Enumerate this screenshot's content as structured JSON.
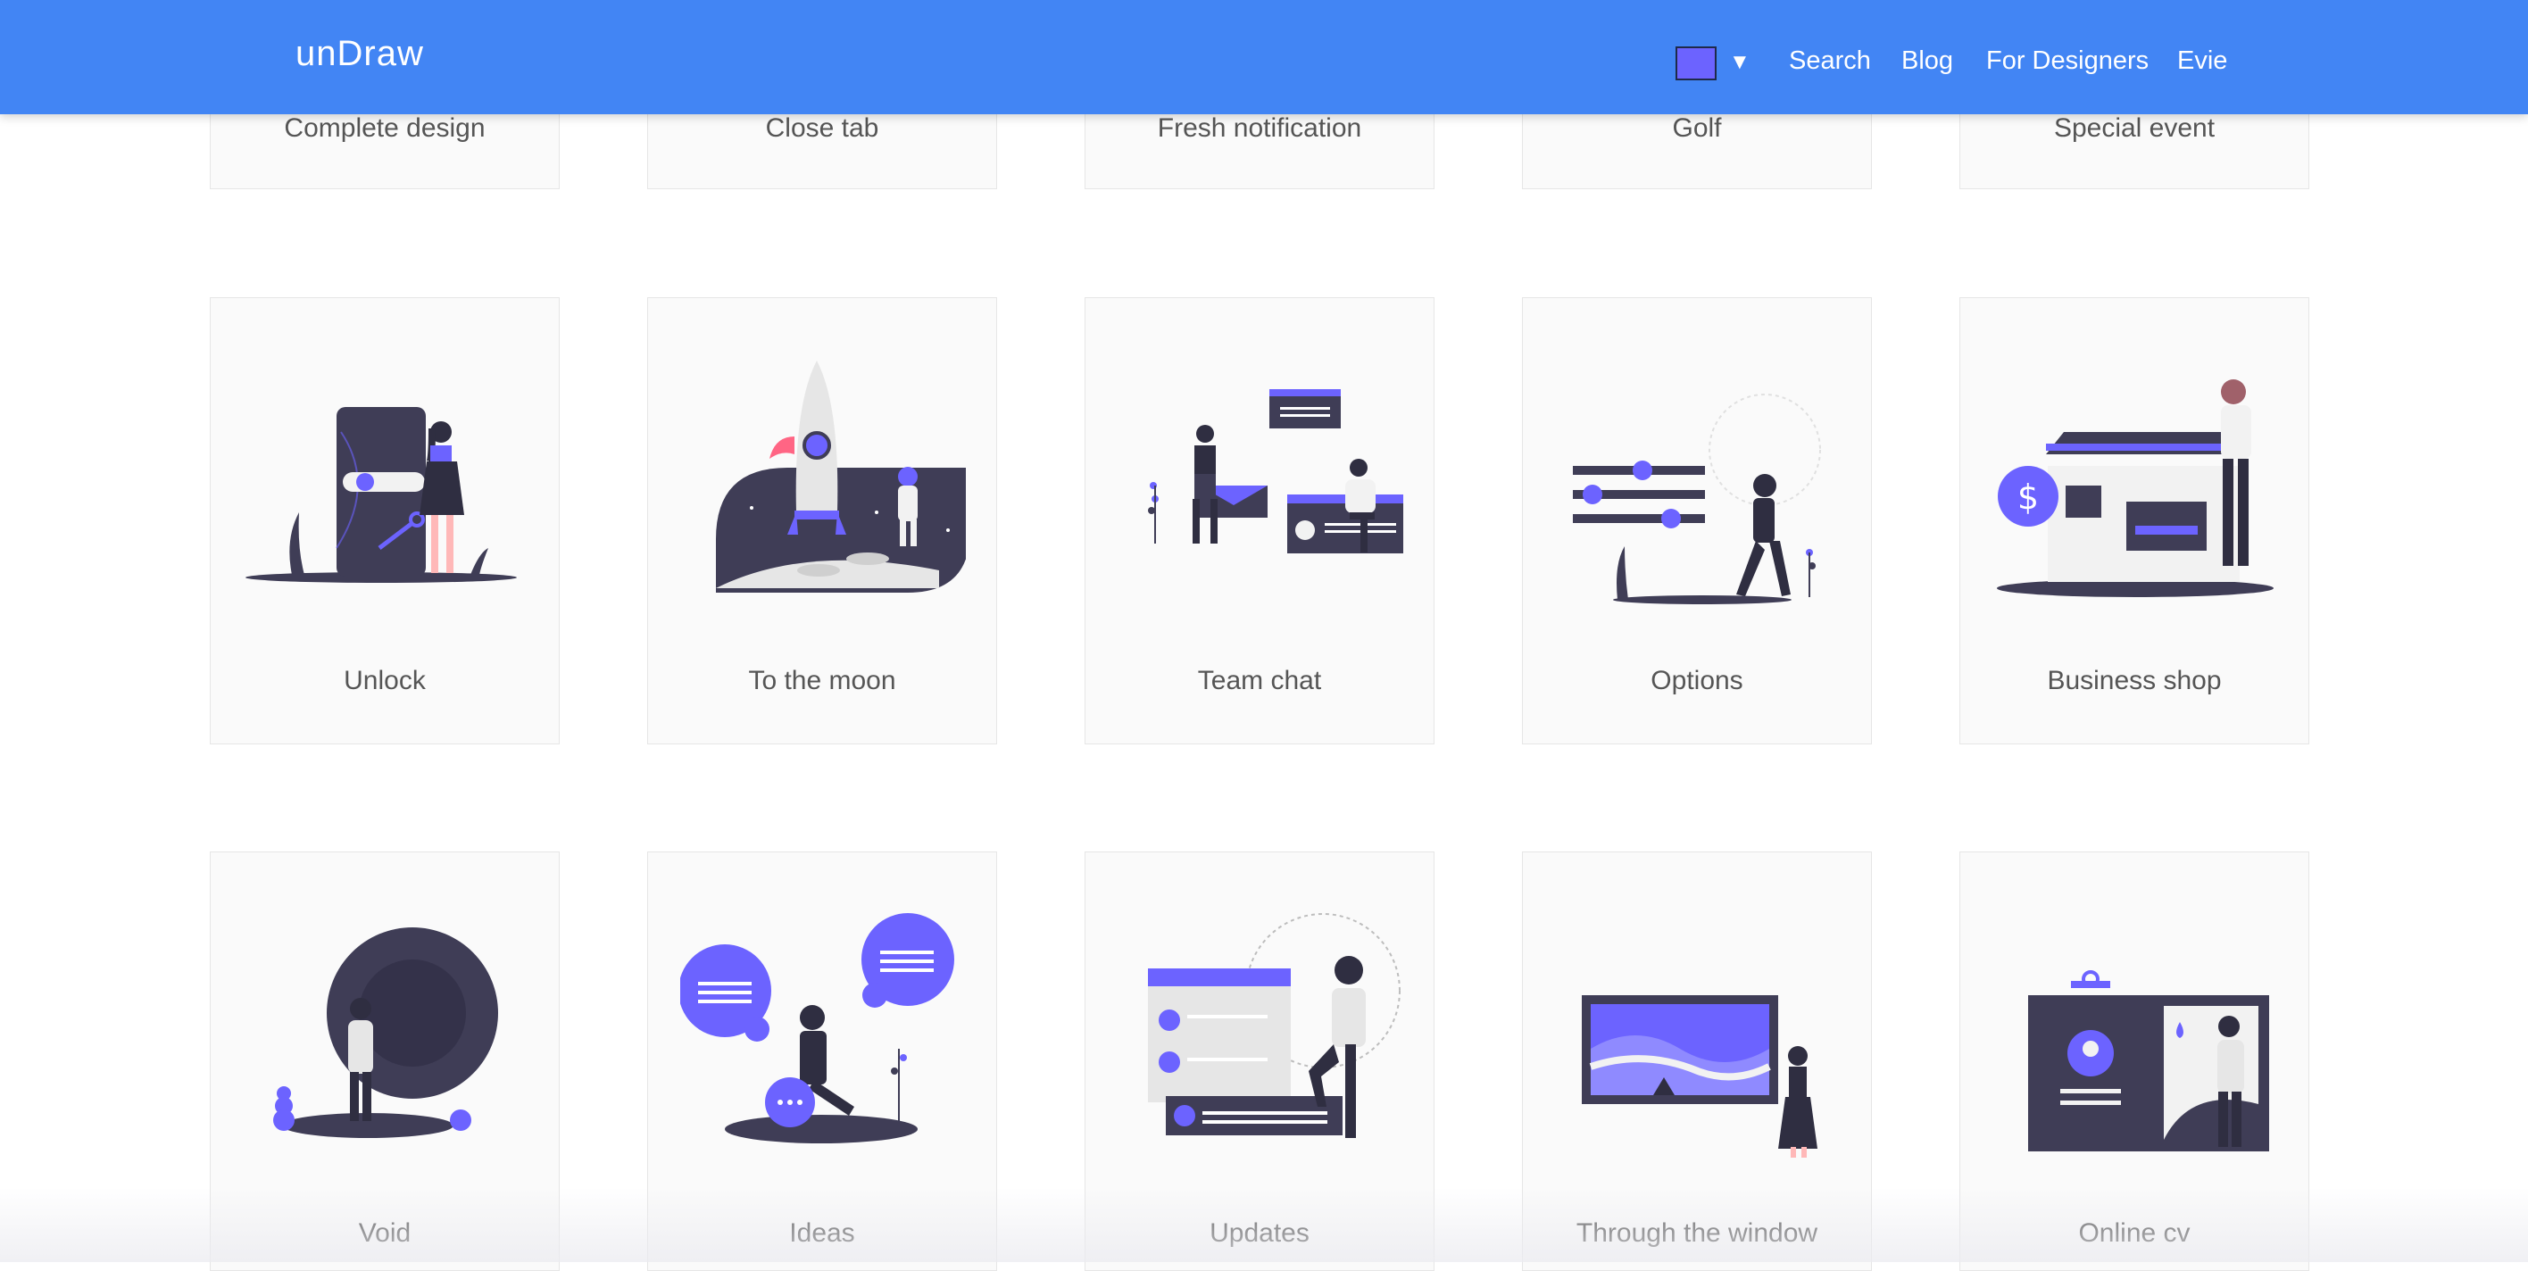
{
  "nav": {
    "logo": "unDraw",
    "color_picker": {
      "color": "#6c63ff",
      "caret": "▼"
    },
    "links": [
      "Search",
      "Blog",
      "For Designers",
      "Evie"
    ]
  },
  "colors": {
    "nav_bg": "#4285f4",
    "accent": "#6c63ff",
    "dark": "#3f3d56"
  },
  "illustrations_row_top": [
    "Complete design",
    "Close tab",
    "Fresh notification",
    "Golf",
    "Special event"
  ],
  "illustrations_row_middle": [
    "Unlock",
    "To the moon",
    "Team chat",
    "Options",
    "Business shop"
  ],
  "illustrations_row_bottom": [
    "Void",
    "Ideas",
    "Updates",
    "Through the window",
    "Online cv"
  ]
}
